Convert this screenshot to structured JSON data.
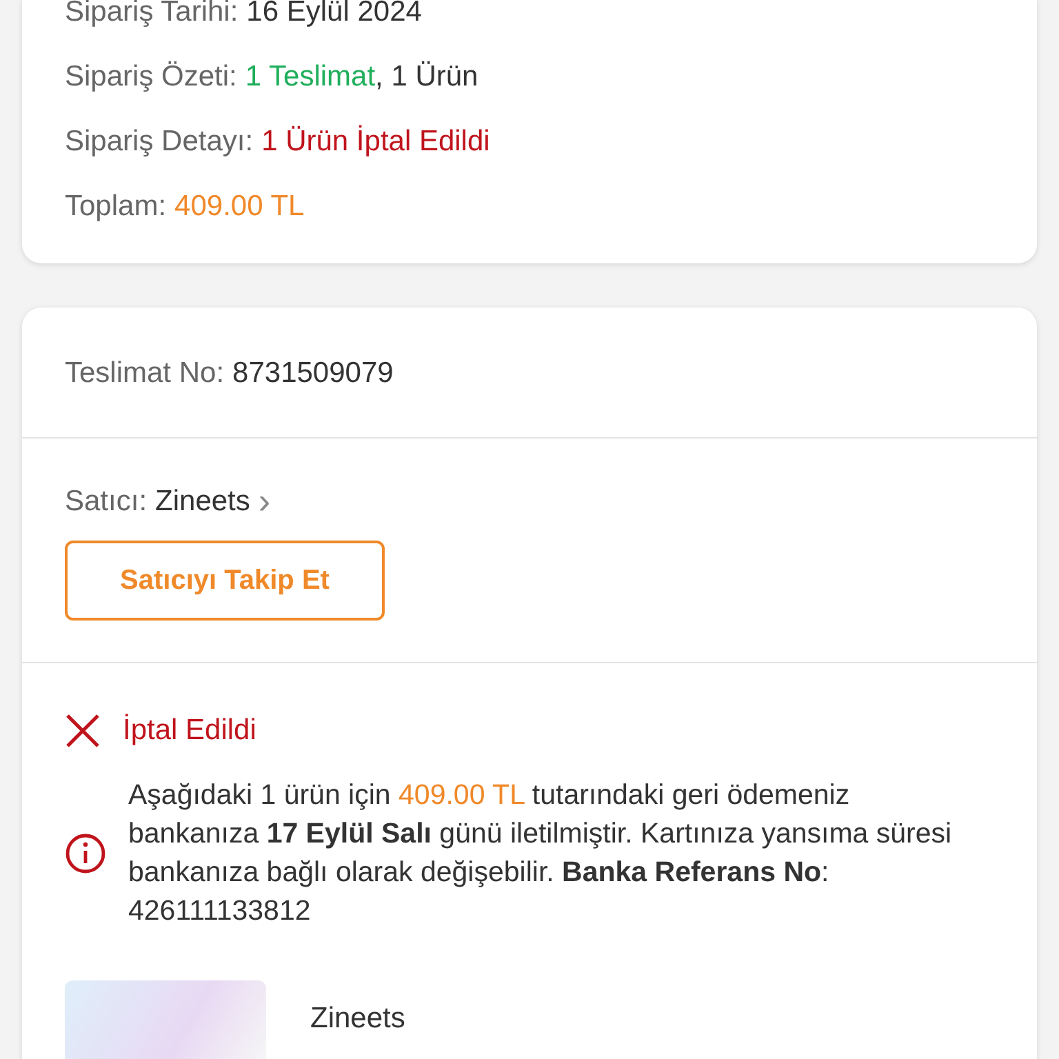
{
  "order_summary": {
    "rows": [
      {
        "label": "Sipariş Tarihi:",
        "parts": [
          {
            "text": "16 Eylül 2024",
            "kind": "dark"
          }
        ]
      },
      {
        "label": "Sipariş Özeti:",
        "parts": [
          {
            "text": "1 Teslimat",
            "kind": "green"
          },
          {
            "text": ", 1 Ürün",
            "kind": "dark"
          }
        ]
      },
      {
        "label": "Sipariş Detayı:",
        "parts": [
          {
            "text": "1 Ürün İptal Edildi",
            "kind": "red"
          }
        ]
      },
      {
        "label": "Toplam:",
        "parts": [
          {
            "text": "409.00 TL",
            "kind": "orange"
          }
        ]
      }
    ]
  },
  "delivery": {
    "label": "Teslimat No:",
    "number": "8731509079",
    "seller": {
      "label": "Satıcı:",
      "name": "Zineets",
      "chevron": "›"
    },
    "follow_button": "Satıcıyı Takip Et",
    "status": {
      "kind": "cancelled",
      "text": "İptal Edildi"
    },
    "notice": [
      {
        "text": "Aşağıdaki 1 ürün için ",
        "kind": "plain"
      },
      {
        "text": "409.00 TL",
        "kind": "orange"
      },
      {
        "text": " tutarındaki geri ödemeniz bankanıza ",
        "kind": "plain"
      },
      {
        "text": "17 Eylül Salı",
        "kind": "bold"
      },
      {
        "text": " günü iletilmiştir. Kartınıza yansıma süresi bankanıza bağlı olarak değişebilir. ",
        "kind": "plain"
      },
      {
        "text": "Banka Referans No",
        "kind": "bold"
      },
      {
        "text": ": 426111133812",
        "kind": "plain"
      }
    ],
    "product": {
      "brand": "Zineets"
    }
  }
}
